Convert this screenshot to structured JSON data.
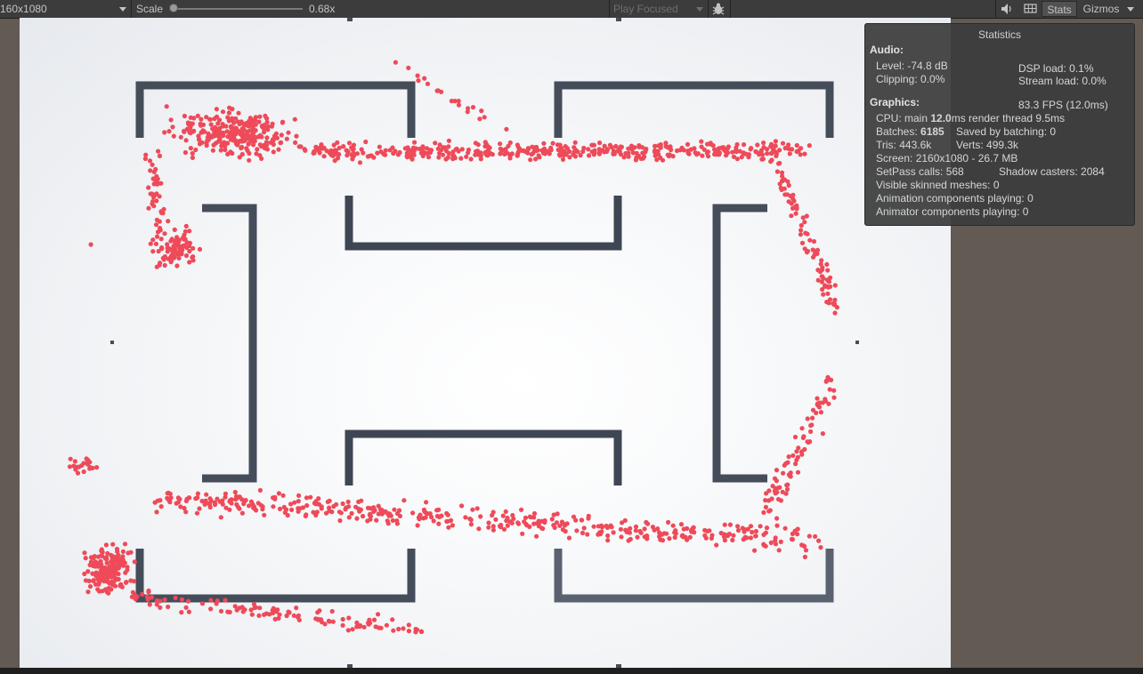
{
  "toolbar": {
    "resolution": "160x1080",
    "scale_label": "Scale",
    "scale_value": "0.68x",
    "scale_fraction": 0.0,
    "play_mode": "Play Focused",
    "stats_label": "Stats",
    "gizmos_label": "Gizmos",
    "icons": [
      "dropdown-arrow-icon",
      "bug-icon",
      "audio-icon",
      "grid-icon"
    ]
  },
  "stats": {
    "title": "Statistics",
    "audio_header": "Audio:",
    "level": "Level: -74.8 dB",
    "clipping": "Clipping: 0.0%",
    "dsp_load": "DSP load: 0.1%",
    "stream_load": "Stream load: 0.0%",
    "graphics_header": "Graphics:",
    "fps": "83.3 FPS (12.0ms)",
    "cpu_prefix": "CPU: main ",
    "cpu_main": "12.0",
    "cpu_suffix": "ms  render thread 9.5ms",
    "batches_prefix": "Batches: ",
    "batches_value": "6185",
    "saved_batching": "Saved by batching: 0",
    "tris": "Tris: 443.6k",
    "verts": "Verts: 499.3k",
    "screen": "Screen: 2160x1080 - 26.7 MB",
    "setpass": "SetPass calls: 568",
    "shadow_casters": "Shadow casters: 2084",
    "skinned": "Visible skinned meshes: 0",
    "animation": "Animation components playing: 0",
    "animator": "Animator components playing: 0"
  },
  "colors": {
    "toolbar": "#3c3c3c",
    "wall": "#454d5a",
    "particle": "#ee4a59",
    "panel": "#3c3c3c"
  }
}
